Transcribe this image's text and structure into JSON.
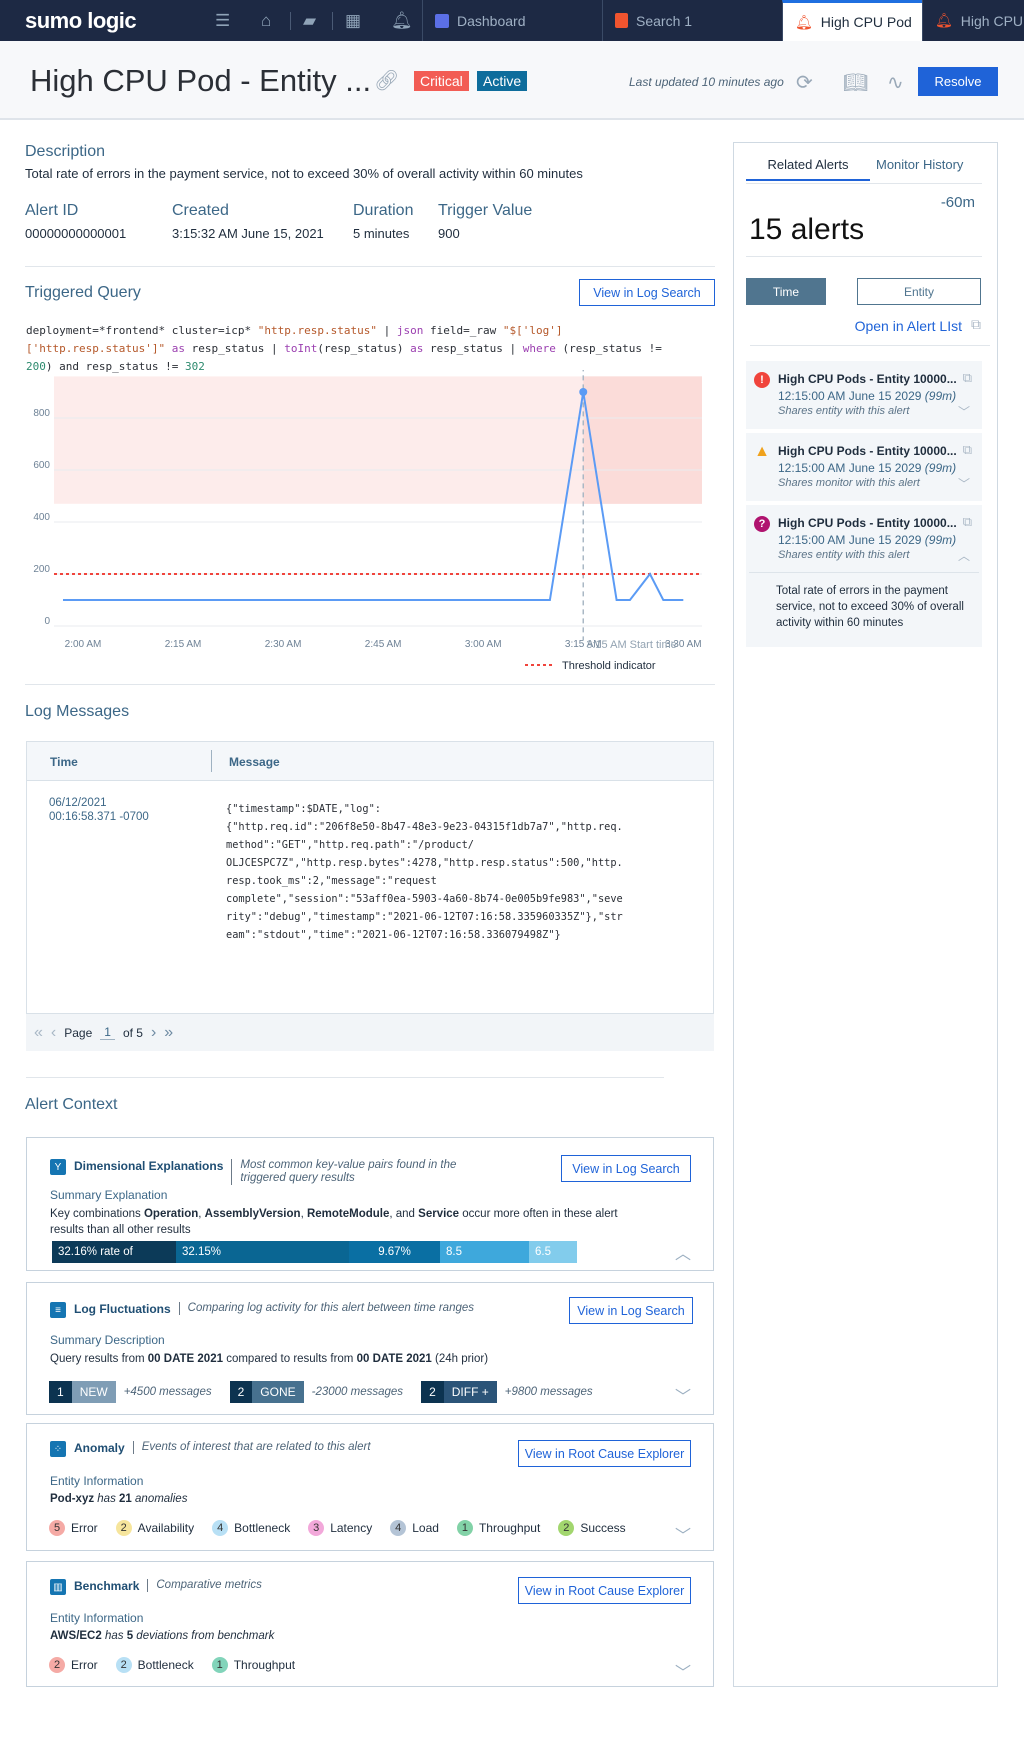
{
  "topbar": {
    "logo": "sumo logic",
    "tabs": [
      {
        "label": "Dashboard",
        "icon": "dashboard-icon",
        "color": "#5b6fe6"
      },
      {
        "label": "Search 1",
        "icon": "search-doc-icon",
        "color": "#f0542f"
      },
      {
        "label": "High CPU Pod",
        "icon": "bell-icon",
        "color": "#f0542f",
        "active": true
      },
      {
        "label": "High CPU",
        "icon": "bell-icon",
        "color": "#f0542f"
      }
    ]
  },
  "header": {
    "title": "High CPU Pod - Entity ...",
    "severity": "Critical",
    "severity_color": "#f25c54",
    "status": "Active",
    "status_color": "#0e6d9c",
    "last_updated": "Last updated 10 minutes ago",
    "resolve_label": "Resolve"
  },
  "details": {
    "description_label": "Description",
    "description": "Total rate of errors in the payment service, not to exceed 30% of overall activity within 60 minutes",
    "fields": [
      {
        "label": "Alert ID",
        "value": "00000000000001"
      },
      {
        "label": "Created",
        "value": "3:15:32 AM June 15, 2021"
      },
      {
        "label": "Duration",
        "value": "5 minutes"
      },
      {
        "label": "Trigger Value",
        "value": "900"
      }
    ]
  },
  "query": {
    "label": "Triggered Query",
    "view_button": "View in Log Search",
    "tokens": {
      "t1": "deployment=*frontend* cluster=icp* ",
      "t2": "\"http.resp.status\"",
      "t3": " | ",
      "t4": "json",
      "t5": " field=_raw ",
      "t6": "\"$['log']",
      "t7": "['http.resp.status']\"",
      "t8": " as",
      "t9": " resp_status | ",
      "t10": "toInt",
      "t11": "(resp_status) ",
      "t12": "as",
      "t13": " resp_status | ",
      "t14": "where",
      "t15": " (resp_status !=",
      "t16": "200",
      "t17": ") and resp_status != ",
      "t18": "302"
    }
  },
  "chart_data": {
    "type": "line",
    "x": [
      "1:57",
      "3:10",
      "3:15",
      "3:20",
      "3:22",
      "3:25",
      "3:27",
      "3:30"
    ],
    "values": [
      100,
      100,
      900,
      100,
      100,
      200,
      100,
      100
    ],
    "x_ticks": [
      "2:00 AM",
      "2:15 AM",
      "2:30 AM",
      "2:45 AM",
      "3:00 AM",
      "3:15 AM",
      "3:30 AM"
    ],
    "y_ticks": [
      0,
      200,
      400,
      600,
      800
    ],
    "ylim": [
      0,
      960
    ],
    "threshold": 200,
    "threshold_label": "Threshold indicator",
    "alert_band": [
      470,
      960
    ],
    "start_marker": "3:15",
    "start_label": "3:15 AM Start time",
    "line_color": "#5b9bf5",
    "threshold_color": "#f0443c",
    "band_color": "#fdeceb",
    "grid": true
  },
  "logs": {
    "label": "Log Messages",
    "columns": [
      "Time",
      "Message"
    ],
    "rows": [
      {
        "time_date": "06/12/2021",
        "time_clock": "00:16:58.371 -0700",
        "message": "{\"timestamp\":$DATE,\"log\":\n{\"http.req.id\":\"206f8e50-8b47-48e3-9e23-04315f1db7a7\",\"http.req.\nmethod\":\"GET\",\"http.req.path\":\"/product/\nOLJCESPC7Z\",\"http.resp.bytes\":4278,\"http.resp.status\":500,\"http.\nresp.took_ms\":2,\"message\":\"request\ncomplete\",\"session\":\"53aff0ea-5903-4a60-8b74-0e005b9fe983\",\"seve\nrity\":\"debug\",\"timestamp\":\"2021-06-12T07:16:58.335960335Z\"},\"str\neam\":\"stdout\",\"time\":\"2021-06-12T07:16:58.336079498Z\"}"
      }
    ],
    "pager": {
      "page_label": "Page",
      "page": "1",
      "of_label": "of 5"
    }
  },
  "context": {
    "label": "Alert Context",
    "dimensional": {
      "title": "Dimensional Explanations",
      "subtitle": "Most common key-value pairs found in the triggered query results",
      "button": "View in Log Search",
      "summary_label": "Summary Explanation",
      "s1": "Key combinations ",
      "b1": "Operation",
      "s2": ", ",
      "b2": "AssemblyVersion",
      "s3": ", ",
      "b3": "RemoteModule",
      "s4": ", and ",
      "b4": "Service",
      "s5": " occur more often in these alert results than all other results",
      "bar": [
        {
          "label": "32.16% rate of",
          "value": 32.16,
          "color": "#0c3a58"
        },
        {
          "label": "32.15%",
          "value": 32.15,
          "color": "#0a6693"
        },
        {
          "label": "9.67%",
          "value": 9.67,
          "color": "#0a6fa3"
        },
        {
          "label": "8.5",
          "value": 8.5,
          "color": "#3ea8dc"
        },
        {
          "label": "6.5",
          "value": 6.5,
          "color": "#82ccec"
        }
      ]
    },
    "fluctuations": {
      "title": "Log Fluctuations",
      "subtitle": "Comparing log activity for this alert between time ranges",
      "button": "View in Log Search",
      "summary_label": "Summary Description",
      "s1": "Query results from ",
      "b1": "00 DATE 2021",
      "s2": " compared to results from ",
      "b2": "00 DATE 2021",
      "s3": " (24h prior)",
      "chips": [
        {
          "count": "1",
          "label": "NEW",
          "messages": "+4500 messages",
          "color": "#7f9db5"
        },
        {
          "count": "2",
          "label": "GONE",
          "messages": "-23000 messages",
          "color": "#47718f"
        },
        {
          "count": "2",
          "label": "DIFF +",
          "messages": "+9800 messages",
          "color": "#2b5478"
        }
      ]
    },
    "anomaly": {
      "title": "Anomaly",
      "subtitle": "Events of interest that are related to this alert",
      "button": "View in Root Cause Explorer",
      "info_label": "Entity Information",
      "entity": "Pod-xyz",
      "has": " has ",
      "count": "21",
      "suffix": " anomalies",
      "pills": [
        {
          "count": "5",
          "label": "Error",
          "color": "#f5aaa5"
        },
        {
          "count": "2",
          "label": "Availability",
          "color": "#f6e59c"
        },
        {
          "count": "4",
          "label": "Bottleneck",
          "color": "#b8e0f5"
        },
        {
          "count": "3",
          "label": "Latency",
          "color": "#f2a8da"
        },
        {
          "count": "4",
          "label": "Load",
          "color": "#b4c4d6"
        },
        {
          "count": "1",
          "label": "Throughput",
          "color": "#82d2a7"
        },
        {
          "count": "2",
          "label": "Success",
          "color": "#a2d66e"
        }
      ]
    },
    "benchmark": {
      "title": "Benchmark",
      "subtitle": "Comparative metrics",
      "button": "View in Root Cause Explorer",
      "info_label": "Entity Information",
      "entity": "AWS/EC2",
      "has": " has ",
      "count": "5",
      "suffix": " deviations from benchmark",
      "pills": [
        {
          "count": "2",
          "label": "Error",
          "color": "#f5aaa5"
        },
        {
          "count": "2",
          "label": "Bottleneck",
          "color": "#b8e0f5"
        },
        {
          "count": "1",
          "label": "Throughput",
          "color": "#82d4ba"
        }
      ]
    }
  },
  "related": {
    "tabs": [
      "Related Alerts",
      "Monitor History"
    ],
    "range": "-60m",
    "count": "15 alerts",
    "filter_time": "Time",
    "filter_entity": "Entity",
    "open_list": "Open in Alert LIst",
    "items": [
      {
        "title": "High CPU Pods - Entity 10000...",
        "date": "12:15:00 AM  June 15 2029",
        "dur": "(99m)",
        "note": "Shares entity with this alert",
        "icon": "error-icon",
        "color": "#f0443c",
        "glyph": "!"
      },
      {
        "title": "High CPU Pods - Entity 10000...",
        "date": "12:15:00 AM  June 15 2029",
        "dur": "(99m)",
        "note": "Shares monitor with this alert",
        "icon": "warning-icon",
        "color": "#f0a21c",
        "glyph": "!"
      },
      {
        "title": "High CPU Pods - Entity 10000...",
        "date": "12:15:00 AM  June 15 2029",
        "dur": "(99m)",
        "note": "Shares entity with this alert",
        "icon": "question-icon",
        "color": "#b0136f",
        "glyph": "?"
      }
    ],
    "expanded_text": "Total rate of errors in the payment service, not to exceed 30% of overall activity within 60 minutes"
  }
}
